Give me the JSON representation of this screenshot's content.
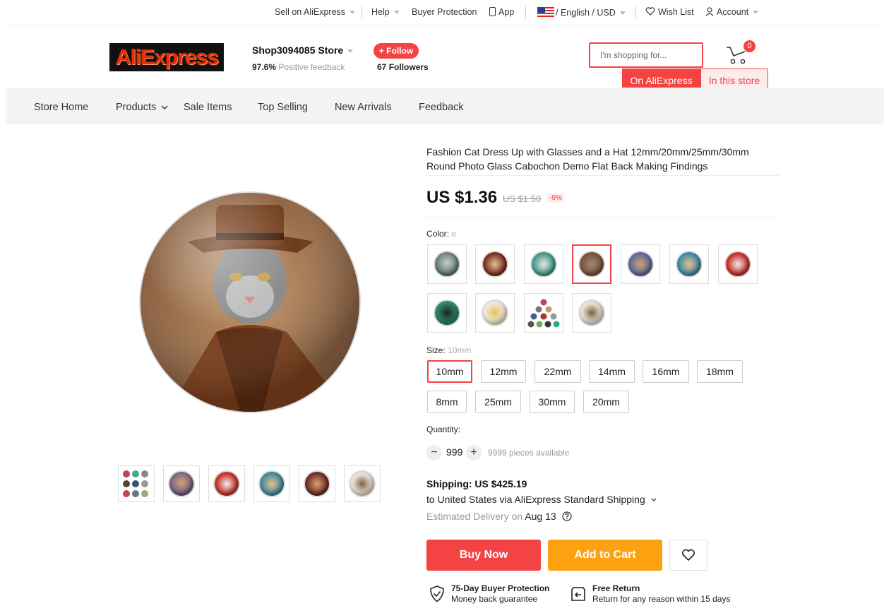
{
  "topbar": {
    "sell": "Sell on AliExpress",
    "help": "Help",
    "buyer_protection": "Buyer Protection",
    "app": "App",
    "language_currency": "/ English / USD",
    "wish_list": "Wish List",
    "account": "Account"
  },
  "header": {
    "logo_text": "AliExpress",
    "store_name": "Shop3094085 Store",
    "feedback_percent": "97.6%",
    "feedback_label": "Positive feedback",
    "follow_label": "+ Follow",
    "followers_count": "67",
    "followers_label": "Followers",
    "search_placeholder": "I'm shopping for...",
    "cart_count": "0",
    "scope_aliexpress": "On AliExpress",
    "scope_store": "In this store"
  },
  "nav": {
    "store_home": "Store Home",
    "products": "Products",
    "sale_items": "Sale Items",
    "top_selling": "Top Selling",
    "new_arrivals": "New Arrivals",
    "feedback": "Feedback"
  },
  "product": {
    "title": "Fashion Cat Dress Up with Glasses and a Hat 12mm/20mm/25mm/30mm Round Photo Glass Cabochon Demo Flat Back Making Findings",
    "price": "US $1.36",
    "original_price": "US $1.50",
    "discount": "-9%",
    "color_label": "Color:",
    "color_value": "e",
    "size_label": "Size:",
    "size_value": "10mm",
    "sizes": [
      "10mm",
      "12mm",
      "22mm",
      "14mm",
      "16mm",
      "18mm",
      "8mm",
      "25mm",
      "30mm",
      "20mm"
    ],
    "quantity_label": "Quantity:",
    "quantity_minus": "−",
    "quantity_value": "999",
    "quantity_plus": "+",
    "quantity_available": "9999 pieces available",
    "shipping_title": "Shipping: US $425.19",
    "shipping_via": "to United States via AliExpress Standard Shipping",
    "delivery_prefix": "Estimated Delivery on",
    "delivery_date": "Aug 13",
    "buy_now": "Buy Now",
    "add_to_cart": "Add to Cart",
    "protection_title": "75-Day Buyer Protection",
    "protection_sub": "Money back guarantee",
    "return_title": "Free Return",
    "return_sub": "Return for any reason within 15 days"
  },
  "colors": {
    "accent": "#f44343",
    "cart_orange": "#fca211",
    "nav_bg": "#f4f4f4"
  }
}
